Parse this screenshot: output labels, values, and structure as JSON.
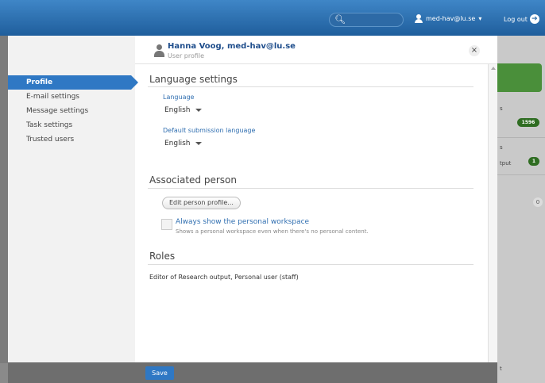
{
  "topbar": {
    "search_placeholder": "",
    "user_label": "med-hav@lu.se",
    "logout_label": "Log out"
  },
  "header": {
    "name": "Hanna Voog, med-hav@lu.se",
    "subtitle": "User profile",
    "close_glyph": "×"
  },
  "sidebar": {
    "items": [
      {
        "label": "Profile",
        "active": true
      },
      {
        "label": "E-mail settings",
        "active": false
      },
      {
        "label": "Message settings",
        "active": false
      },
      {
        "label": "Task settings",
        "active": false
      },
      {
        "label": "Trusted users",
        "active": false
      }
    ]
  },
  "language": {
    "title": "Language settings",
    "language_label": "Language",
    "language_value": "English",
    "submission_label": "Default submission language",
    "submission_value": "English"
  },
  "associated": {
    "title": "Associated person",
    "edit_button": "Edit person profile...",
    "workspace_label": "Always show the personal workspace",
    "workspace_help": "Shows a personal workspace even when there's no personal content.",
    "workspace_checked": false
  },
  "roles": {
    "title": "Roles",
    "text": "Editor of Research output, Personal user (staff)"
  },
  "footer": {
    "save_label": "Save"
  },
  "background": {
    "fragments": [
      "s",
      "s",
      "tput",
      "t"
    ],
    "badges": [
      "1596",
      "1"
    ],
    "zero": "0"
  },
  "icons": {
    "search": "search-icon",
    "user": "user-icon",
    "logout": "logout-icon",
    "close": "close-icon",
    "person": "person-icon"
  },
  "colors": {
    "accent": "#2f78c4",
    "topbar": "#1f5e9c",
    "link": "#2f6eb0",
    "badge": "#2f6d22"
  }
}
